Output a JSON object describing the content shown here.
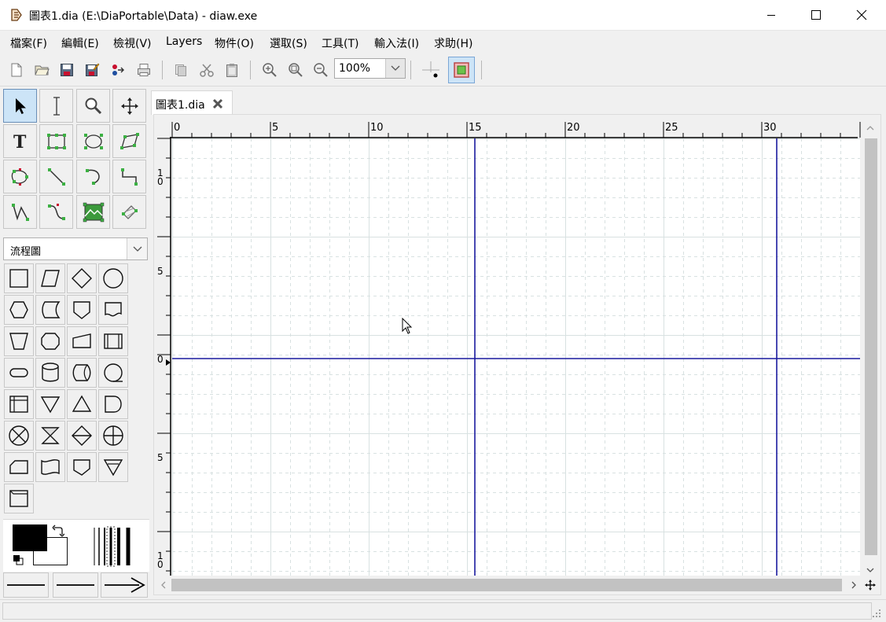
{
  "window": {
    "title": "圖表1.dia (E:\\DiaPortable\\Data) - diaw.exe",
    "controls": [
      "minimize",
      "maximize",
      "close"
    ]
  },
  "menu": [
    "檔案(F)",
    "編輯(E)",
    "檢視(V)",
    "Layers",
    "物件(O)",
    "選取(S)",
    "工具(T)",
    "輸入法(I)",
    "求助(H)"
  ],
  "toolbar": {
    "zoom": "100%",
    "icons": [
      "new-file-icon",
      "open-folder-icon",
      "save-icon",
      "save-as-icon",
      "export-icon",
      "print-icon",
      "copy-icon",
      "cut-icon",
      "paste-icon",
      "zoom-in-icon",
      "zoom-fit-icon",
      "zoom-out-icon",
      "snap-to-grid-icon",
      "snap-to-objects-icon"
    ]
  },
  "tools": {
    "rows": [
      [
        "pointer-tool",
        "text-edit-tool",
        "magnify-tool",
        "scroll-tool"
      ],
      [
        "text-tool",
        "box-tool",
        "ellipse-tool",
        "polygon-tool"
      ],
      [
        "beziergon-tool",
        "line-tool",
        "arc-tool",
        "zigzagline-tool"
      ],
      [
        "polyline-tool",
        "bezierline-tool",
        "image-tool",
        "outline-tool"
      ]
    ],
    "active": "pointer-tool"
  },
  "sheet": {
    "selected": "流程圖",
    "shapes": [
      [
        "process",
        "input-output",
        "decision",
        "connector"
      ],
      [
        "preparation",
        "magnetic-drum",
        "offpage-connector",
        "document"
      ],
      [
        "manual-operation",
        "hexagon",
        "manual-input",
        "predefined-process"
      ],
      [
        "terminal",
        "magnetic-disk",
        "direct-access-storage",
        "sequential-data"
      ],
      [
        "internal-storage",
        "merge",
        "extract",
        "delay"
      ],
      [
        "summing-junction",
        "collate",
        "sort",
        "or"
      ],
      [
        "card",
        "punched-tape",
        "offline-storage",
        "transfer"
      ],
      [
        "auxiliary-operation"
      ]
    ]
  },
  "colors": {
    "foreground": "#000000",
    "background": "#ffffff",
    "guide": "#1a1a9e",
    "grid": "#d8e1e1",
    "page_bg": "#ffffff"
  },
  "tab": {
    "label": "圖表1.dia"
  },
  "ruler": {
    "top_labels": [
      "0",
      "5",
      "10",
      "15",
      "20",
      "25",
      "30"
    ],
    "left_labels": [
      "10",
      "5",
      "0",
      "5",
      "10"
    ]
  },
  "status": {
    "text": ""
  }
}
